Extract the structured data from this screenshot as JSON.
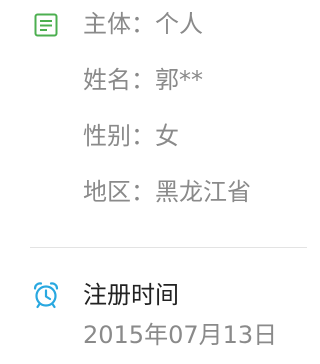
{
  "info": {
    "items": [
      {
        "label": "主体：",
        "value": "个人"
      },
      {
        "label": "姓名：",
        "value": "郭**"
      },
      {
        "label": "性别：",
        "value": "女"
      },
      {
        "label": "地区：",
        "value": "黑龙江省"
      }
    ],
    "icon": "document-icon",
    "icon_color": "#4caf50"
  },
  "registration": {
    "title": "注册时间",
    "date": "2015年07月13日",
    "icon": "alarm-clock-icon",
    "icon_color": "#29a8e0"
  },
  "colors": {
    "label_text": "#8a8a8a",
    "title_text": "#222222",
    "divider": "#e3e3e3"
  }
}
